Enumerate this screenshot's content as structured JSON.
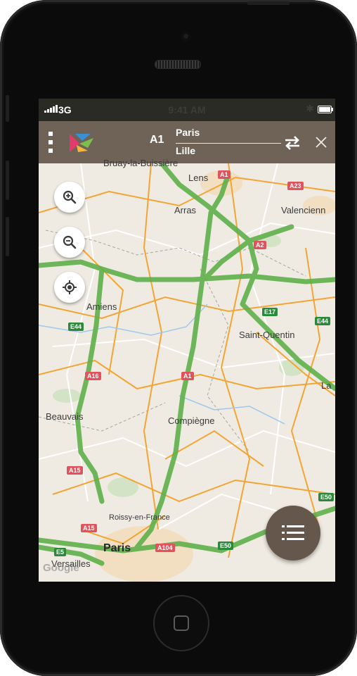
{
  "status_bar": {
    "network": "3G",
    "time": "9:41 AM",
    "bluetooth_icon": "bluetooth-icon",
    "battery_icon": "battery-icon"
  },
  "header": {
    "menu_icon": "kebab-menu-icon",
    "logo_icon": "app-logo-icon",
    "road": "A1",
    "origin": "Paris",
    "destination": "Lille",
    "swap_icon": "swap-arrows-icon",
    "close_icon": "close-icon",
    "color": "#6f6358"
  },
  "map_controls": {
    "zoom_in_icon": "zoom-in-icon",
    "zoom_out_icon": "zoom-out-icon",
    "locate_icon": "my-location-icon"
  },
  "map": {
    "places": {
      "bruay": "Bruay-la-Buissière",
      "lens": "Lens",
      "arras": "Arras",
      "valenciennes": "Valencienn",
      "amiens": "Amiens",
      "saint_quentin": "Saint-Quentin",
      "la": "La",
      "beauvais": "Beauvais",
      "compiegne": "Compiègne",
      "roissy": "Roissy-en-France",
      "paris": "Paris",
      "versailles": "Versailles",
      "watermark": "Google"
    },
    "shields": {
      "a1_top": "A1",
      "a23": "A23",
      "a2": "A2",
      "e17": "E17",
      "e44_right": "E44",
      "e44_left": "E44",
      "a16": "A16",
      "a1_mid": "A1",
      "a15_mid": "A15",
      "a15_low": "A15",
      "e5": "E5",
      "a104": "A104",
      "e50": "E50",
      "e50_right": "E50"
    },
    "route_color": "#5fb04b",
    "road_color": "#f3a534"
  },
  "list_button_icon": "list-icon"
}
